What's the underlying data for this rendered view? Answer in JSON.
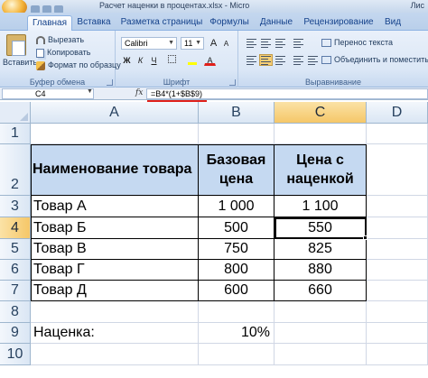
{
  "window": {
    "title": "Расчет наценки в процентах.xlsx - Micro",
    "title_right": "Лис"
  },
  "tabs": [
    "Главная",
    "Вставка",
    "Разметка страницы",
    "Формулы",
    "Данные",
    "Рецензирование",
    "Вид"
  ],
  "ribbon": {
    "clipboard": {
      "paste_label": "Вставить",
      "cut_label": "Вырезать",
      "copy_label": "Копировать",
      "format_painter_label": "Формат по образцу",
      "group_label": "Буфер обмена"
    },
    "font": {
      "font_name": "Calibri",
      "font_size": "11",
      "bold": "Ж",
      "italic": "К",
      "underline": "Ч",
      "font_color_letter": "A",
      "grow": "A",
      "shrink": "A",
      "group_label": "Шрифт"
    },
    "alignment": {
      "wrap_label": "Перенос текста",
      "merge_label": "Объединить и поместить в ц",
      "group_label": "Выравнивание"
    }
  },
  "formula_bar": {
    "name_box": "C4",
    "fx_label": "fx",
    "formula": "=B4*(1+$B$9)"
  },
  "columns": [
    {
      "label": "A"
    },
    {
      "label": "B"
    },
    {
      "label": "C"
    },
    {
      "label": "D"
    }
  ],
  "rows": [
    "1",
    "2",
    "3",
    "4",
    "5",
    "6",
    "7",
    "8",
    "9",
    "10"
  ],
  "sheet": {
    "header_name": "Наименование товара",
    "header_base": "Базовая цена",
    "header_markup": "Цена с наценкой",
    "items": [
      {
        "name": "Товар А",
        "base": "1 000",
        "marked": "1 100"
      },
      {
        "name": "Товар Б",
        "base": "500",
        "marked": "550"
      },
      {
        "name": "Товар В",
        "base": "750",
        "marked": "825"
      },
      {
        "name": "Товар Г",
        "base": "800",
        "marked": "880"
      },
      {
        "name": "Товар Д",
        "base": "600",
        "marked": "660"
      }
    ],
    "markup_label": "Наценка:",
    "markup_value": "10%"
  },
  "selection": {
    "active_cell": "C4",
    "active_column": "C",
    "active_row": "4"
  },
  "colors": {
    "header_fill": "#c5d9f1",
    "selected_header": "#f5c768",
    "formula_highlight": "#e0201a"
  }
}
